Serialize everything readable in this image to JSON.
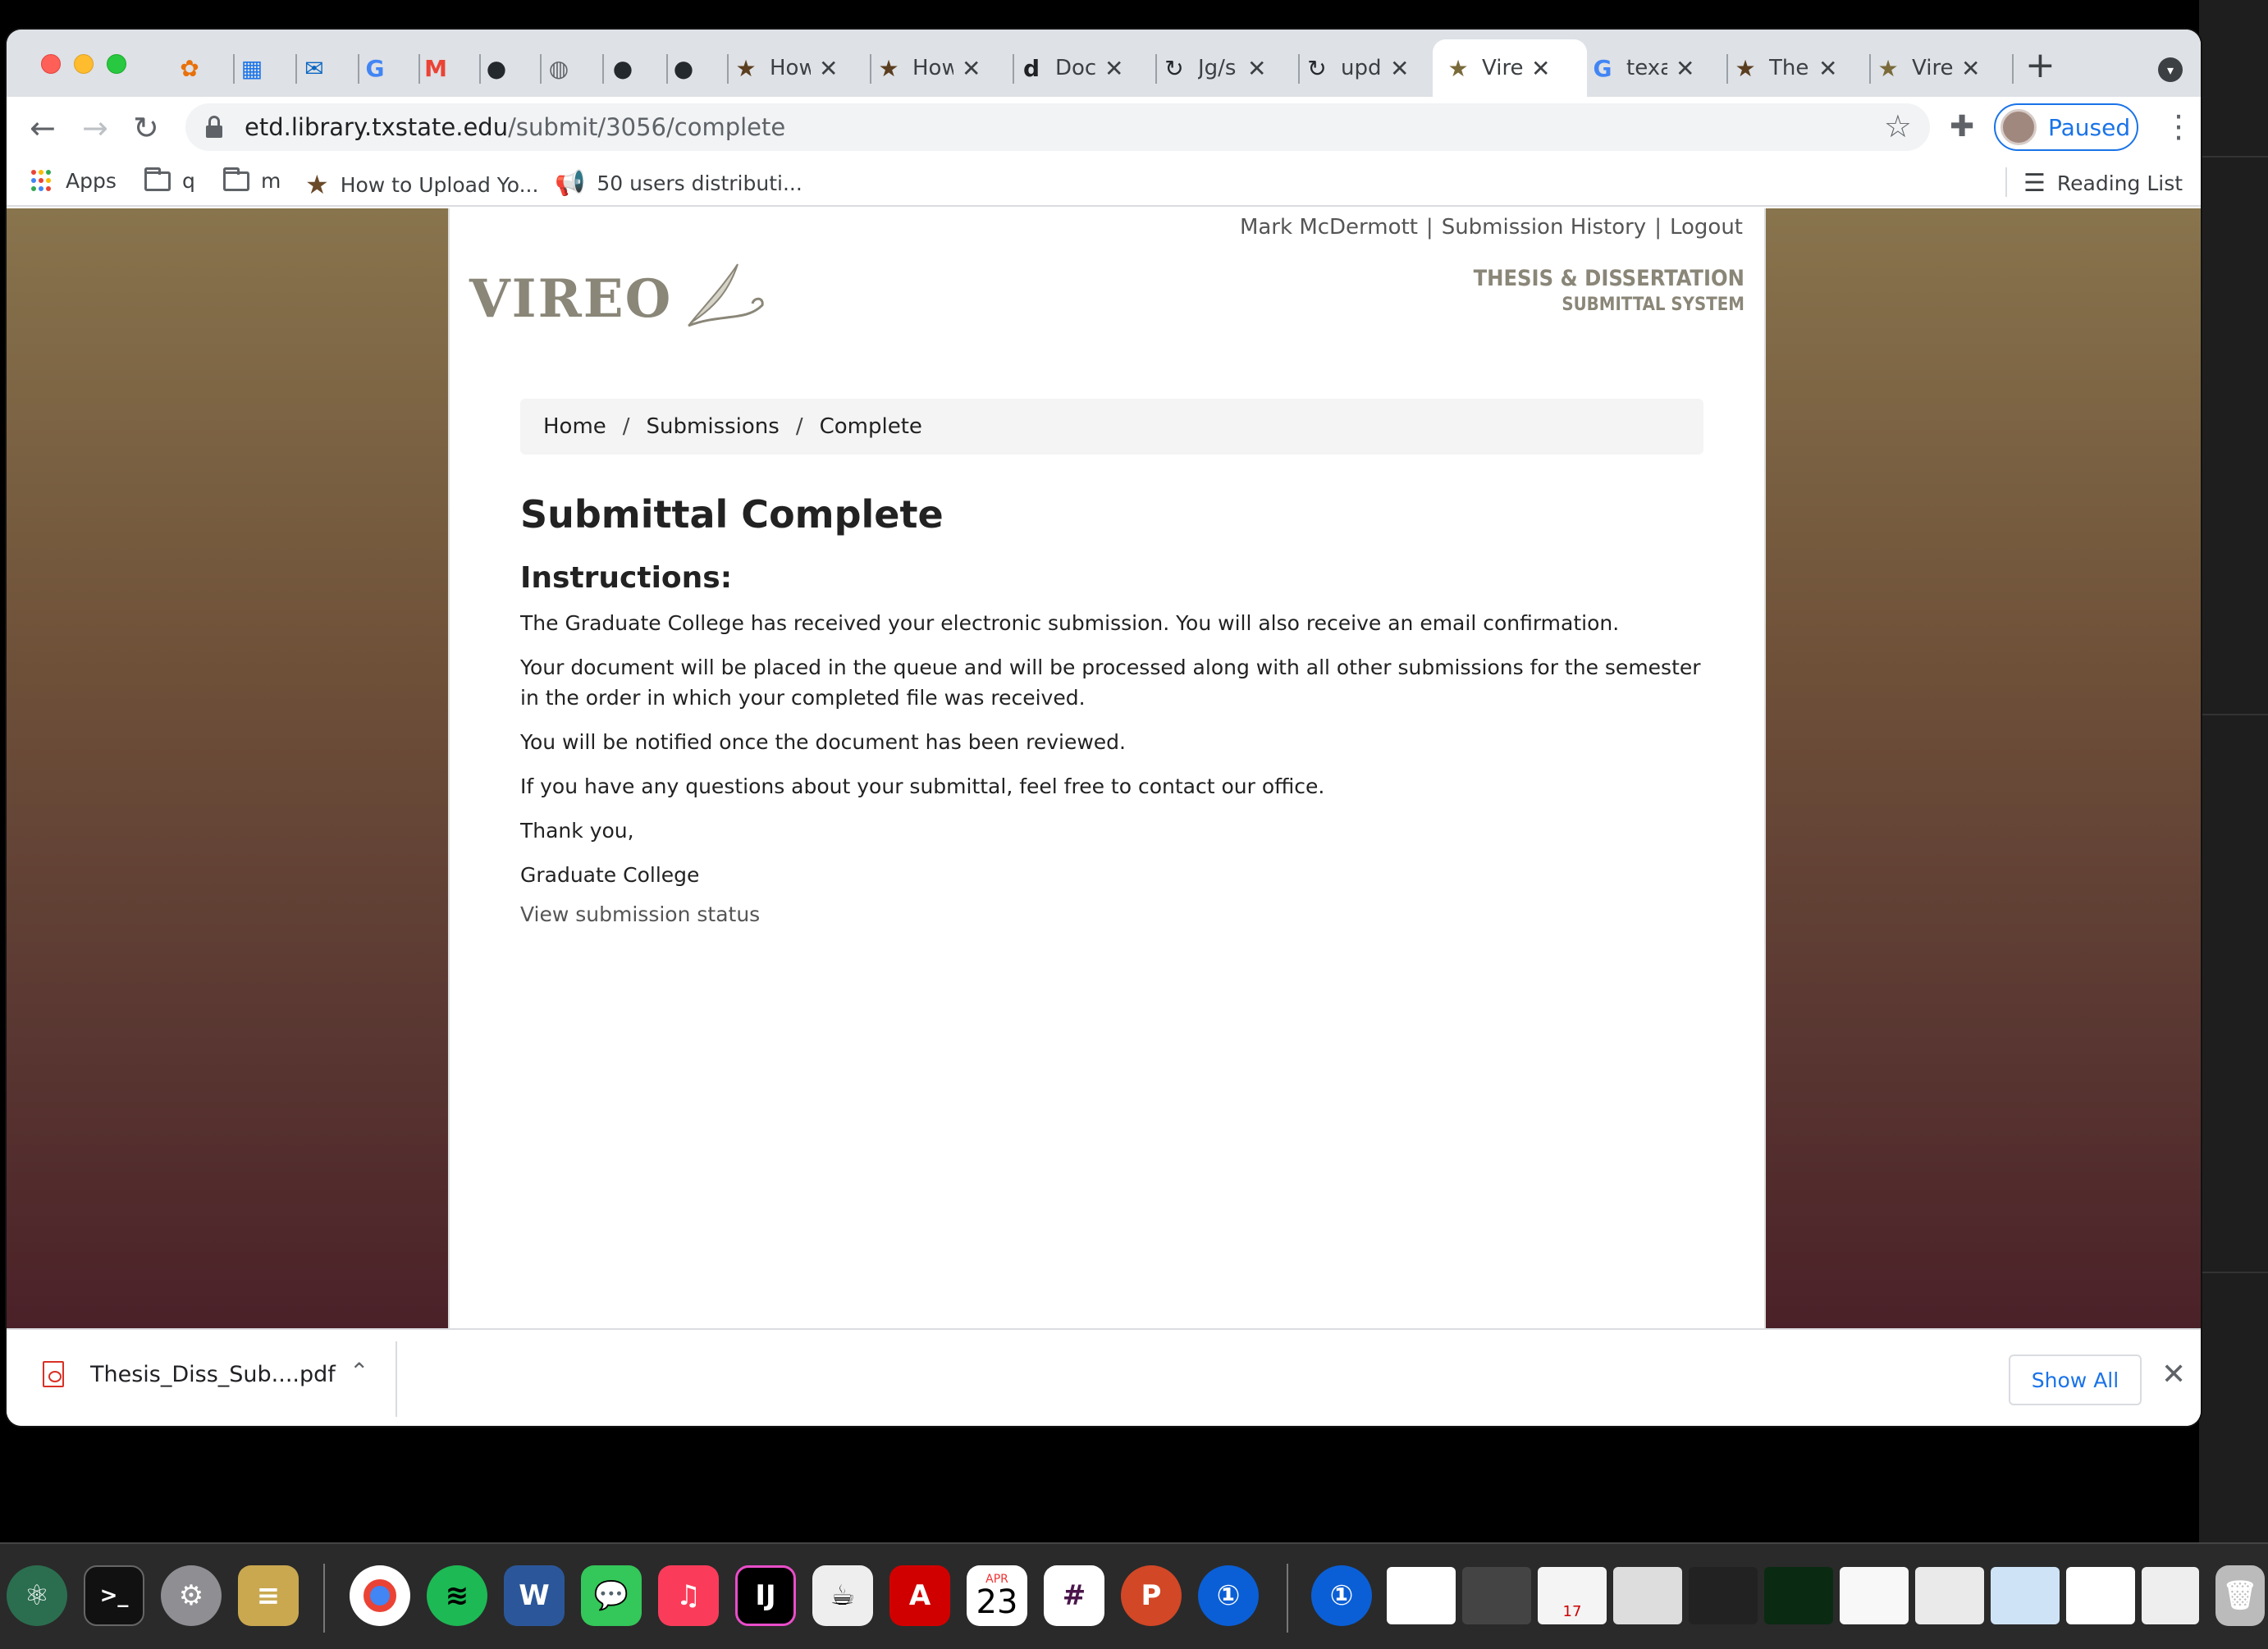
{
  "browser": {
    "tabs": [
      {
        "icon": "app-icon",
        "title": ""
      },
      {
        "icon": "calendar-icon",
        "title": ""
      },
      {
        "icon": "outlook-icon",
        "title": ""
      },
      {
        "icon": "google-icon",
        "title": ""
      },
      {
        "icon": "gmail-icon",
        "title": ""
      },
      {
        "icon": "github-icon",
        "title": ""
      },
      {
        "icon": "globe-icon",
        "title": ""
      },
      {
        "icon": "github-icon",
        "title": ""
      },
      {
        "icon": "github-icon",
        "title": ""
      },
      {
        "icon": "star-icon",
        "title": "How"
      },
      {
        "icon": "star-icon",
        "title": "How"
      },
      {
        "icon": "d-icon",
        "title": "Doc"
      },
      {
        "icon": "sync-icon",
        "title": "Jg/s"
      },
      {
        "icon": "sync-icon",
        "title": "upd"
      },
      {
        "icon": "vireo-star-icon",
        "title": "Vire",
        "active": true
      },
      {
        "icon": "google-icon",
        "title": "texa"
      },
      {
        "icon": "star-icon",
        "title": "The"
      },
      {
        "icon": "vireo-star-icon",
        "title": "Vire"
      }
    ],
    "url": {
      "host": "etd.library.txstate.edu",
      "path": "/submit/3056/complete"
    },
    "profile_label": "Paused",
    "bookmarks": [
      {
        "label": "Apps",
        "icon": "apps-grid-icon"
      },
      {
        "label": "q",
        "icon": "folder-icon"
      },
      {
        "label": "m",
        "icon": "folder-icon"
      },
      {
        "label": "How to Upload Yo...",
        "icon": "star-icon"
      },
      {
        "label": "50 users distributi...",
        "icon": "megaphone-icon"
      }
    ],
    "reading_list_label": "Reading List"
  },
  "page": {
    "user_name": "Mark McDermott",
    "nav": {
      "history": "Submission History",
      "logout": "Logout",
      "separator": "|"
    },
    "logo_text": "VIREO",
    "system_title_1": "THESIS & DISSERTATION",
    "system_title_2": "SUBMITTAL SYSTEM",
    "breadcrumb": [
      "Home",
      "Submissions",
      "Complete"
    ],
    "breadcrumb_sep": "/",
    "heading": "Submittal Complete",
    "subheading": "Instructions:",
    "paragraphs": [
      "The Graduate College has received your electronic submission. You will also receive an email confirmation.",
      "Your document will be placed in the queue and will be processed along with all other submissions for the semester in the order in which your completed file was received.",
      "You will be notified once the document has been reviewed.",
      "If you have any questions about your submittal, feel free to contact our office.",
      "Thank you,",
      "Graduate College"
    ],
    "status_link": "View submission status"
  },
  "download_shelf": {
    "filename": "Thesis_Diss_Sub....pdf",
    "show_all": "Show All"
  },
  "dock": {
    "calendar_month": "APR",
    "calendar_day": "23",
    "thumb_calendar_day": "17"
  }
}
